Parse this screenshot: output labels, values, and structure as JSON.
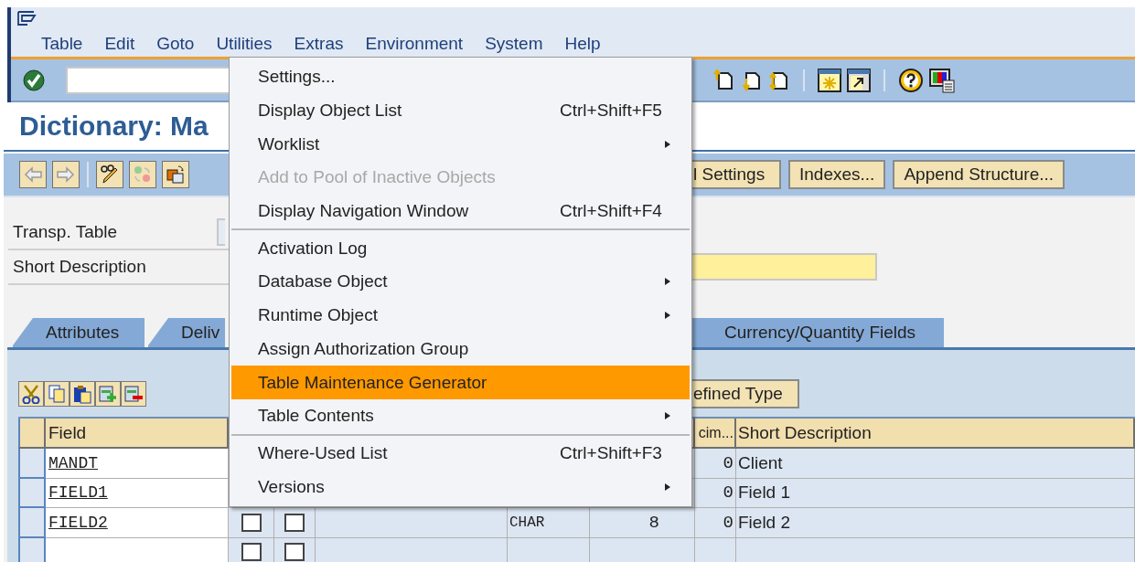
{
  "menu_bar": {
    "items": [
      {
        "label": "Table"
      },
      {
        "label": "Edit"
      },
      {
        "label": "Goto"
      },
      {
        "label": "Utilities"
      },
      {
        "label": "Extras"
      },
      {
        "label": "Environment"
      },
      {
        "label": "System"
      },
      {
        "label": "Help"
      }
    ]
  },
  "title": "Dictionary: Ma",
  "application_toolbar": {
    "buttons": [
      "l Settings",
      "Indexes...",
      "Append Structure..."
    ]
  },
  "form": {
    "fields": [
      {
        "label": "Transp. Table",
        "editable": false
      },
      {
        "label": "Short Description",
        "editable": true
      }
    ]
  },
  "tabs": [
    {
      "label": "Attributes",
      "selected": false
    },
    {
      "label": "Deliv",
      "selected": false
    },
    {
      "label": "Currency/Quantity Fields",
      "selected": false
    }
  ],
  "table": {
    "toolbar_buttons": [
      "efined Type"
    ],
    "columns": [
      {
        "label": "Field"
      },
      {
        "label": "cim..."
      },
      {
        "label": "Short Description"
      }
    ],
    "rows": [
      {
        "field": "MANDT",
        "decimals": "0",
        "short_description": "Client"
      },
      {
        "field": "FIELD1",
        "decimals": "0",
        "short_description": "Field 1"
      },
      {
        "field": "FIELD2",
        "key": false,
        "initial": false,
        "data_type": "CHAR",
        "length": "8",
        "decimals": "0",
        "short_description": "Field 2"
      },
      {
        "key": false,
        "initial": false
      }
    ]
  },
  "menu": {
    "groups": [
      [
        {
          "label": "Settings...",
          "disabled": false,
          "selected": false,
          "submenu": false
        },
        {
          "label": "Display Object List",
          "shortcut": "Ctrl+Shift+F5",
          "disabled": false,
          "selected": false,
          "submenu": false
        },
        {
          "label": "Worklist",
          "disabled": false,
          "selected": false,
          "submenu": true
        },
        {
          "label": "Add to Pool of Inactive Objects",
          "disabled": true,
          "selected": false,
          "submenu": false
        },
        {
          "label": "Display Navigation Window",
          "shortcut": "Ctrl+Shift+F4",
          "disabled": false,
          "selected": false,
          "submenu": false
        }
      ],
      [
        {
          "label": "Activation Log",
          "disabled": false,
          "selected": false,
          "submenu": false
        },
        {
          "label": "Database Object",
          "disabled": false,
          "selected": false,
          "submenu": true
        },
        {
          "label": "Runtime Object",
          "disabled": false,
          "selected": false,
          "submenu": true
        },
        {
          "label": "Assign Authorization Group",
          "disabled": false,
          "selected": false,
          "submenu": false
        },
        {
          "label": "Table Maintenance Generator",
          "disabled": false,
          "selected": true,
          "submenu": false
        },
        {
          "label": "Table Contents",
          "disabled": false,
          "selected": false,
          "submenu": true
        }
      ],
      [
        {
          "label": "Where-Used List",
          "shortcut": "Ctrl+Shift+F3",
          "disabled": false,
          "selected": false,
          "submenu": false
        },
        {
          "label": "Versions",
          "disabled": false,
          "selected": false,
          "submenu": true
        }
      ]
    ]
  }
}
